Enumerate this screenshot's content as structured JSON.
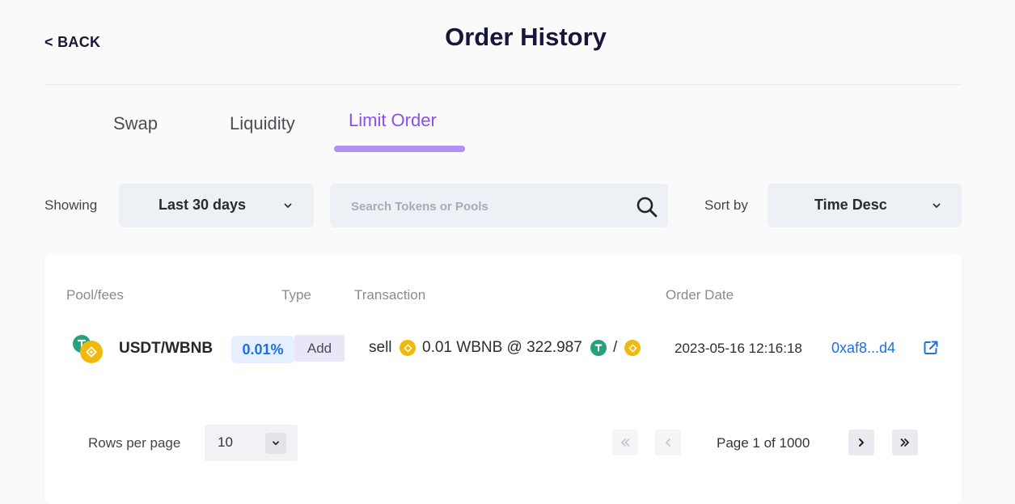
{
  "header": {
    "back_label": "< BACK",
    "title": "Order History"
  },
  "tabs": [
    {
      "label": "Swap",
      "active": false
    },
    {
      "label": "Liquidity",
      "active": false
    },
    {
      "label": "Limit Order",
      "active": true
    }
  ],
  "filters": {
    "showing_label": "Showing",
    "period_value": "Last 30 days",
    "search_placeholder": "Search Tokens or Pools",
    "sort_label": "Sort by",
    "sort_value": "Time Desc"
  },
  "table": {
    "columns": [
      "Pool/fees",
      "Type",
      "Transaction",
      "Order Date"
    ],
    "rows": [
      {
        "pair": "USDT/WBNB",
        "fee": "0.01%",
        "type": "Add",
        "tx_action": "sell",
        "tx_amount": "0.01 WBNB @ 322.987",
        "tx_separator": "/",
        "date": "2023-05-16 12:16:18",
        "tx_hash": "0xaf8...d4"
      }
    ]
  },
  "pagination": {
    "rows_per_page_label": "Rows per page",
    "rows_per_page_value": "10",
    "page_text": "Page 1 of 1000"
  },
  "colors": {
    "accent": "#8c4ff0",
    "link": "#1c6fe9",
    "usdt": "#26a17b",
    "bnb": "#f0b90b"
  },
  "icons": [
    "chevron-down-icon",
    "search-icon",
    "usdt-icon",
    "bnb-icon",
    "external-link-icon",
    "first-page-icon",
    "prev-page-icon",
    "next-page-icon",
    "last-page-icon"
  ]
}
